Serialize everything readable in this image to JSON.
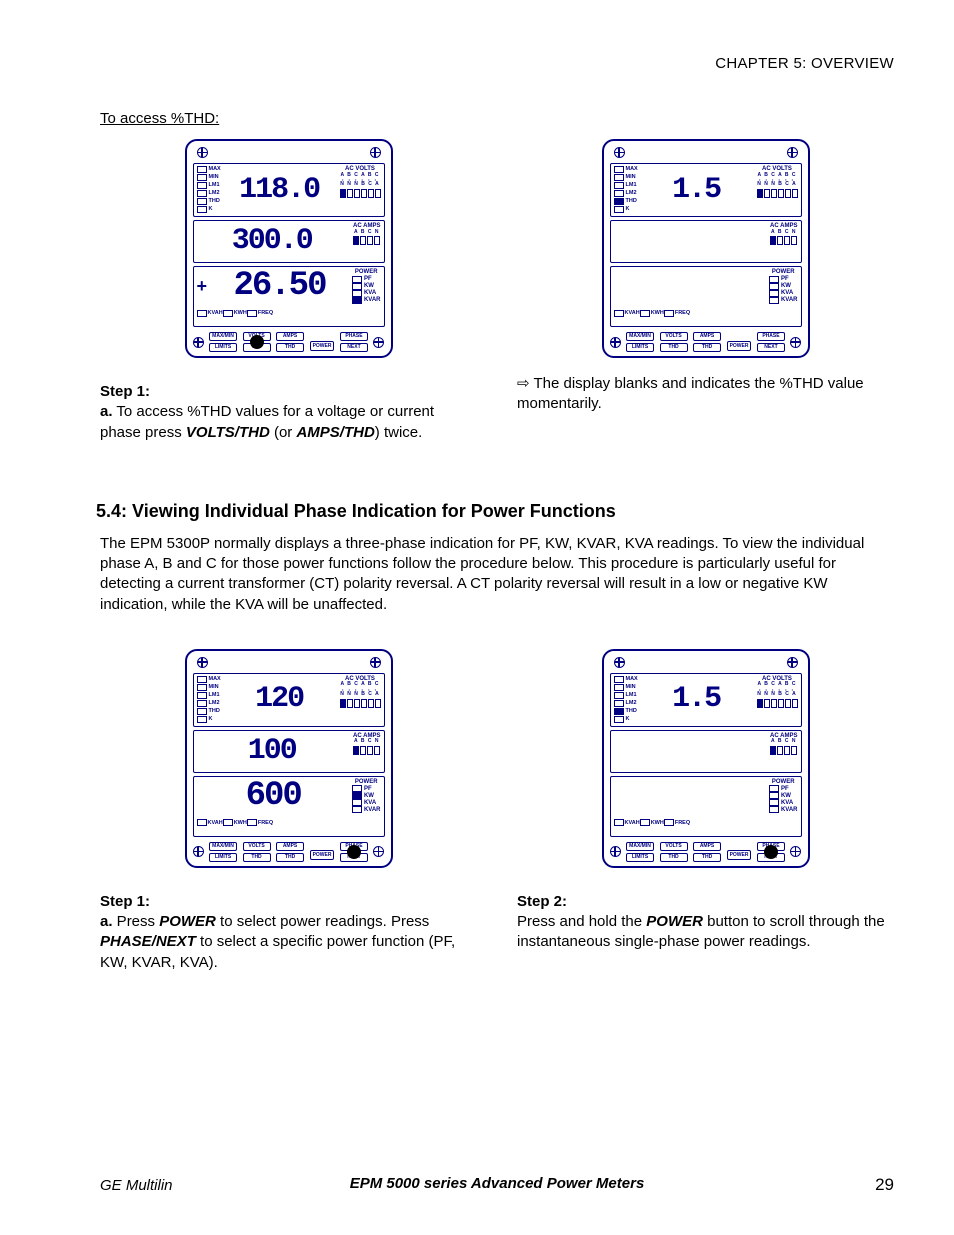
{
  "chapter": "CHAPTER 5: OVERVIEW",
  "access_header": "To access %THD:",
  "section_5_4_title": "5.4: Viewing Individual Phase Indication for Power Functions",
  "section_5_4_body": "The EPM 5300P normally displays a three-phase indication for PF, KW, KVAR, KVA readings. To view the individual phase A, B and C for those power functions follow the procedure below. This procedure is particularly useful for detecting a current transformer (CT) polarity reversal. A CT polarity reversal will result in a low or negative KW indication, while the KVA will be unaffected.",
  "thd": {
    "left": {
      "step_label": "Step 1:",
      "a_prefix": "a.",
      "a_text_1": " To access %THD values for a voltage or current phase press ",
      "btn1": "VOLTS/THD",
      "mid": " (or ",
      "btn2": "AMPS/THD",
      "a_text_2": ") twice."
    },
    "right": {
      "arrow": "⇨",
      "text": " The display blanks and indicates the %THD value momentarily."
    }
  },
  "phase": {
    "left": {
      "step_label": "Step 1:",
      "a_prefix": "a.",
      "a_text_1": " Press ",
      "btn1": "POWER",
      "mid": " to select power readings. Press ",
      "btn2": "PHASE/NEXT",
      "a_text_2": " to select a specific power function (PF, KW, KVAR, KVA)."
    },
    "right": {
      "step_label": "Step 2:",
      "text_1": "Press and hold the ",
      "btn": "POWER",
      "text_2": " button to scroll through the instantaneous single-phase power readings."
    }
  },
  "meter_labels": {
    "side_flags": [
      "MAX",
      "MIN",
      "LM1",
      "LM2",
      "THD",
      "K"
    ],
    "ac_volts": "AC VOLTS",
    "ac_amps": "AC AMPS",
    "power": "POWER",
    "abc_volts": "A B C A B C",
    "nnn": "N N N B C A",
    "abcn": "A B C N",
    "p_flags": [
      "PF",
      "KW",
      "KVA",
      "KVAR"
    ],
    "kv_row": [
      "KVAH",
      "KWH",
      "FREQ"
    ],
    "buttons": [
      [
        "MAX/MIN",
        "LIMITS"
      ],
      [
        "VOLTS",
        "THD"
      ],
      [
        "AMPS",
        "THD"
      ],
      [
        "POWER"
      ],
      [
        "PHASE",
        "NEXT"
      ]
    ]
  },
  "meters": {
    "thd_left": {
      "volts": "118.0",
      "amps": "300.0",
      "power": "26.50",
      "thd_fill": false,
      "press": "volts",
      "p_fill": 3,
      "show_plus": true
    },
    "thd_right": {
      "volts": "1.5",
      "amps": "",
      "power": "",
      "thd_fill": true,
      "press": null,
      "p_fill": -1,
      "show_plus": false
    },
    "ph_left": {
      "volts": "120",
      "amps": "100",
      "power": "600",
      "thd_fill": false,
      "press": "phase",
      "p_fill": 1,
      "show_plus": false
    },
    "ph_right": {
      "volts": "1.5",
      "amps": "",
      "power": "",
      "thd_fill": true,
      "press": "phase",
      "p_fill": -1,
      "show_plus": false
    }
  },
  "footer": {
    "left": "GE Multilin",
    "center": "EPM 5000 series Advanced Power Meters",
    "right": "29"
  }
}
